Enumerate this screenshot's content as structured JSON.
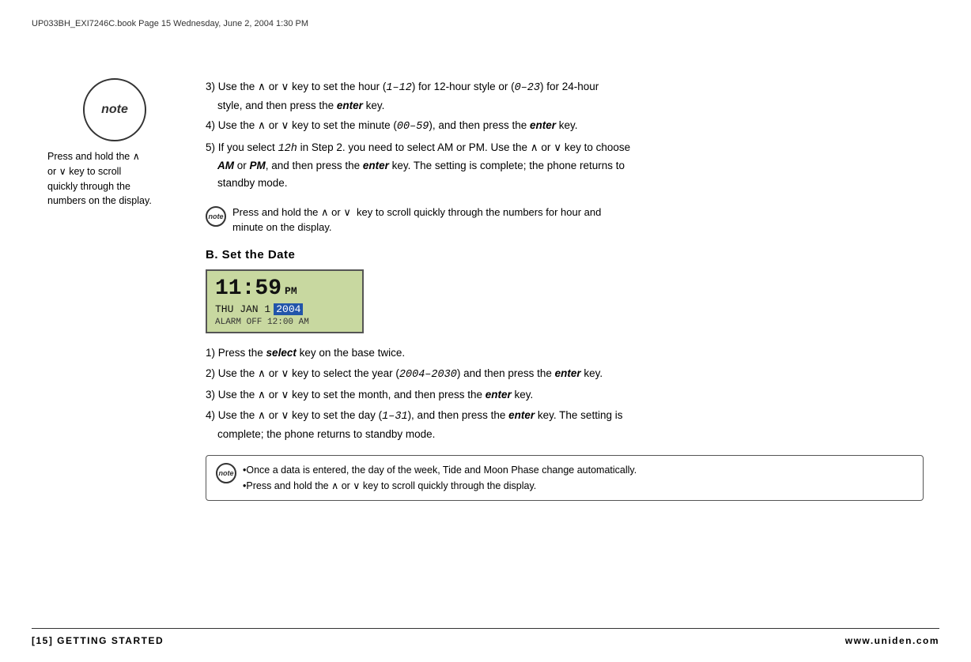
{
  "page": {
    "header_text": "UP033BH_EXI7246C.book  Page 15  Wednesday, June 2, 2004  1:30 PM",
    "footer_left": "[15]  GETTING STARTED",
    "footer_right": "www.uniden.com"
  },
  "sidebar": {
    "note_label": "note",
    "note_text_line1": "Press and hold the",
    "arrow_up": "∧",
    "note_text_line2": "or",
    "arrow_down": "∨",
    "note_text_line3": "key to scroll",
    "note_text_line4": "quickly through the",
    "note_text_line5": "numbers on the display."
  },
  "steps_first": [
    {
      "number": "3)",
      "text_before": "Use the",
      "arrow1": "∧",
      "text_mid1": "or",
      "arrow2": "∨",
      "text_mid2": "key to set the hour (",
      "range": "1–12",
      "text_mid3": ") for 12-hour style or (",
      "range2": "0–23",
      "text_mid4": ") for 24-hour style, and then press the",
      "key": "enter",
      "text_end": "key."
    },
    {
      "number": "4)",
      "text_before": "Use the",
      "arrow1": "∧",
      "text_mid1": "or",
      "arrow2": "∨",
      "text_mid2": "key to set the minute (",
      "range": "00–59",
      "text_mid3": "), and then press the",
      "key": "enter",
      "text_end": "key."
    },
    {
      "number": "5)",
      "text_before": "If you select",
      "range": "12h",
      "text_mid1": "in Step 2. you need to select AM or PM. Use the",
      "arrow1": "∧",
      "text_mid2": "or",
      "arrow2": "∨",
      "text_mid3": "key to choose",
      "key1": "AM",
      "text_mid4": "or",
      "key2": "PM",
      "text_mid5": ", and then press the",
      "key": "enter",
      "text_mid6": "key. The setting is complete; the phone returns to standby mode."
    }
  ],
  "note_inline": {
    "label": "note",
    "text": "Press and hold the ∧ or ∨  key to scroll quickly through the numbers for hour and minute on the display."
  },
  "section_b": {
    "heading": "B. Set the Date",
    "display": {
      "time": "11:59",
      "ampm": "PM",
      "date_line": "THU JAN 1",
      "date_year": "2004",
      "alarm_line": "ALARM OFF 12:00 AM"
    },
    "steps": [
      {
        "number": "1)",
        "text": "Press the",
        "key": "select",
        "text2": "key on the base twice."
      },
      {
        "number": "2)",
        "text": "Use the ∧ or ∨  key to select the year (",
        "range": "2004–2030",
        "text2": ") and then press the",
        "key": "enter",
        "text3": "key."
      },
      {
        "number": "3)",
        "text": "Use the ∧ or ∨  key to set the month, and then press the",
        "key": "enter",
        "text2": "key."
      },
      {
        "number": "4)",
        "text": "Use the ∧ or ∨  key to set the day (",
        "range": "1–31",
        "text2": "), and then press the",
        "key": "enter",
        "text3": "key. The setting is complete; the phone returns to standby mode."
      }
    ],
    "note_box": {
      "label": "note",
      "bullet1": "•Once a data is entered, the day of the week, Tide and Moon Phase change automatically.",
      "bullet2": "•Press and hold the ∧ or ∨  key to scroll quickly through the display."
    }
  }
}
